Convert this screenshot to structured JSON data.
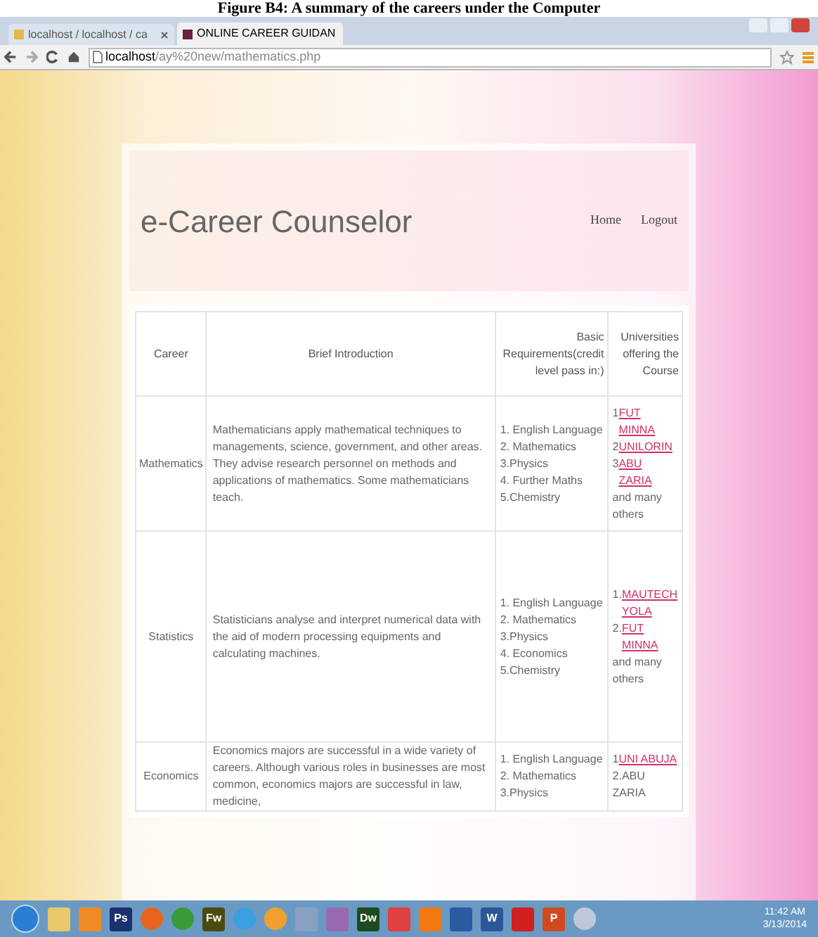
{
  "document_caption": "Figure B4: A summary of the careers under the Computer",
  "browser": {
    "tabs": [
      {
        "label": "localhost / localhost / ca",
        "selected": false
      },
      {
        "label": "ONLINE CAREER GUIDAN",
        "selected": true
      }
    ],
    "address": {
      "host": "localhost",
      "path": "/ay%20new/mathematics.php"
    }
  },
  "site": {
    "title": "e-Career Counselor",
    "nav": [
      "Home",
      "Logout"
    ]
  },
  "table": {
    "columns": [
      "Career",
      "Brief Introduction",
      "Basic Requirements(credit level pass in:)",
      "Universities offering the Course"
    ],
    "rows": [
      {
        "career": "Mathematics",
        "introduction": "Mathematicians apply mathematical techniques to managements, science, government, and other areas. They advise research personnel on methods and applications of mathematics. Some mathematicians teach.",
        "requirements": [
          "1. English Language",
          "2. Mathematics",
          "3.Physics",
          "4. Further Maths",
          "5.Chemistry"
        ],
        "universities": [
          {
            "kind": "link",
            "prefix": "1",
            "name": "FUT MINNA"
          },
          {
            "kind": "link",
            "prefix": "2",
            "name": "UNILORIN"
          },
          {
            "kind": "link",
            "prefix": "3",
            "name": "ABU ZARIA"
          },
          {
            "kind": "text",
            "text": "and many others"
          }
        ]
      },
      {
        "career": "Statistics",
        "introduction": "Statisticians analyse and interpret numerical data with the aid of modern processing equipments and calculating machines.",
        "requirements": [
          "1. English Language",
          "2. Mathematics",
          "3.Physics",
          "4. Economics",
          "5.Chemistry"
        ],
        "universities": [
          {
            "kind": "link",
            "prefix": "1.",
            "name": "MAUTECH YOLA"
          },
          {
            "kind": "link",
            "prefix": "2.",
            "name": "FUT MINNA"
          },
          {
            "kind": "text",
            "text": "and many others"
          }
        ]
      },
      {
        "career": "Economics",
        "introduction": "Economics majors are successful in a wide variety of careers. Although various roles in businesses are most common, economics majors are successful in law, medicine,",
        "requirements": [
          "1. English Language",
          "2. Mathematics",
          "3.Physics"
        ],
        "universities": [
          {
            "kind": "link",
            "prefix": "1",
            "name": "UNI ABUJA"
          },
          {
            "kind": "text",
            "text": "2.ABU ZARIA"
          }
        ]
      }
    ]
  },
  "taskbar": {
    "apps": [
      {
        "kind": "orb",
        "color": "#2a7fd4"
      },
      {
        "kind": "tile",
        "color": "#e8c86a"
      },
      {
        "kind": "tile",
        "color": "#f08a24"
      },
      {
        "kind": "tile",
        "color": "#1c2f6e",
        "label": "Ps"
      },
      {
        "kind": "round",
        "color": "#e8641c"
      },
      {
        "kind": "round",
        "color": "#3a9a3a"
      },
      {
        "kind": "tile",
        "color": "#4b4b10",
        "label": "Fw"
      },
      {
        "kind": "round",
        "color": "#3aa0e0"
      },
      {
        "kind": "round",
        "color": "#f0a030"
      },
      {
        "kind": "tile",
        "color": "#8aa0c0"
      },
      {
        "kind": "tile",
        "color": "#9a6ab0"
      },
      {
        "kind": "tile",
        "color": "#1f4a1f",
        "label": "Dw"
      },
      {
        "kind": "tile",
        "color": "#e04040"
      },
      {
        "kind": "tile",
        "color": "#f07a10"
      },
      {
        "kind": "tile",
        "color": "#2a5aa0"
      },
      {
        "kind": "tile",
        "color": "#2b579a",
        "label": "W"
      },
      {
        "kind": "tile",
        "color": "#d02020"
      },
      {
        "kind": "tile",
        "color": "#d04a20",
        "label": "P"
      },
      {
        "kind": "round",
        "color": "#c0c8d8"
      }
    ],
    "time": "11:42 AM",
    "date": "3/13/2014"
  }
}
